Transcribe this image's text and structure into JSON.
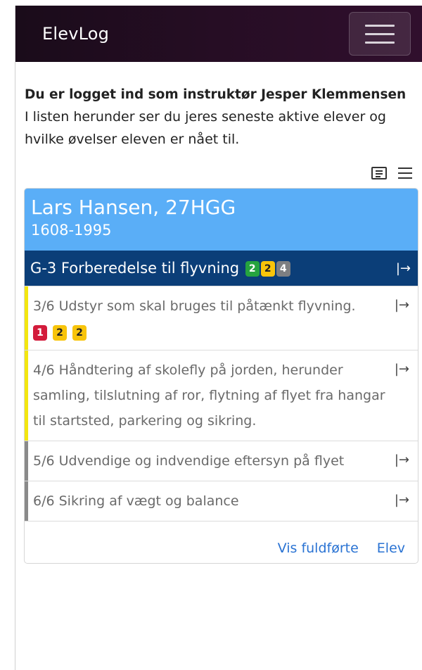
{
  "app": {
    "title": "ElevLog"
  },
  "intro": {
    "instructor_line": "Du er logget ind som instruktør Jesper Klemmensen",
    "description": "I listen herunder ser du jeres seneste aktive elever og hvilke øvelser eleven er nået til."
  },
  "view_toggle": {
    "icons": [
      "list-view-icon",
      "menu-icon"
    ]
  },
  "student": {
    "name": "Lars Hansen, 27HGG",
    "id": "1608-1995"
  },
  "lesson_group": {
    "title": "G-3 Forberedelse til flyvning",
    "badges": [
      {
        "value": "2",
        "color": "#26a33f"
      },
      {
        "value": "2",
        "color": "#f8c40a"
      },
      {
        "value": "4",
        "color": "#7d7f82"
      }
    ]
  },
  "exercises": [
    {
      "text": "3/6 Udstyr som skal bruges til påtænkt flyvning.",
      "bar_color": "#f3e60f",
      "badges": [
        {
          "value": "1",
          "color": "#d31b3b"
        },
        {
          "value": "2",
          "color": "#f8c40a"
        },
        {
          "value": "2",
          "color": "#f8c40a"
        }
      ]
    },
    {
      "text": "4/6 Håndtering af skolefly på jorden, herunder samling, tilslutning af ror, flytning af flyet fra hangar til startsted, parkering og sikring.",
      "bar_color": "#f3e60f",
      "badges": []
    },
    {
      "text": "5/6 Udvendige og indvendige eftersyn på flyet",
      "bar_color": "#8a8a8a",
      "badges": []
    },
    {
      "text": "6/6 Sikring af vægt og balance",
      "bar_color": "#8a8a8a",
      "badges": []
    }
  ],
  "arrow_symbol": "|→",
  "footer": {
    "show_completed": "Vis fuldførte",
    "student_link": "Elev"
  }
}
